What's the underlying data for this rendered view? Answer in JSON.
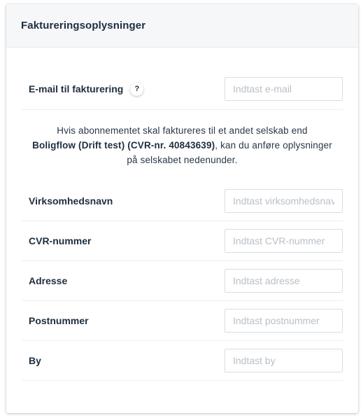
{
  "panel": {
    "title": "Faktureringsoplysninger"
  },
  "billing_email": {
    "label": "E-mail til fakturering",
    "help_icon": "question-mark-icon",
    "help_glyph": "?",
    "placeholder": "Indtast e-mail",
    "value": ""
  },
  "info": {
    "text_before": "Hvis abonnementet skal faktureres til et andet selskab end",
    "company_bold": "Boligflow (Drift test) (CVR-nr. 40843639)",
    "text_after": ", kan du anføre oplysninger på selskabet nedenunder."
  },
  "company_fields": [
    {
      "label": "Virksomhedsnavn",
      "placeholder": "Indtast virksomhedsnavn",
      "value": ""
    },
    {
      "label": "CVR-nummer",
      "placeholder": "Indtast CVR-nummer",
      "value": ""
    },
    {
      "label": "Adresse",
      "placeholder": "Indtast adresse",
      "value": ""
    },
    {
      "label": "Postnummer",
      "placeholder": "Indtast postnummer",
      "value": ""
    },
    {
      "label": "By",
      "placeholder": "Indtast by",
      "value": ""
    }
  ]
}
